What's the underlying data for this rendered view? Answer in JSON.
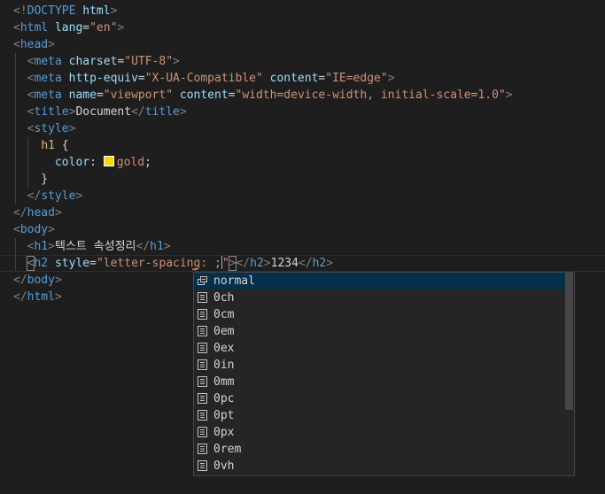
{
  "code_lines": [
    [
      {
        "c": "t-bracket",
        "t": "<!"
      },
      {
        "c": "t-tag",
        "t": "DOCTYPE"
      },
      {
        "c": "t-text",
        "t": " "
      },
      {
        "c": "t-attr",
        "t": "html"
      },
      {
        "c": "t-bracket",
        "t": ">"
      }
    ],
    [
      {
        "c": "t-bracket",
        "t": "<"
      },
      {
        "c": "t-tag",
        "t": "html"
      },
      {
        "c": "t-text",
        "t": " "
      },
      {
        "c": "t-attr",
        "t": "lang"
      },
      {
        "c": "t-text",
        "t": "="
      },
      {
        "c": "t-str",
        "t": "\"en\""
      },
      {
        "c": "t-bracket",
        "t": ">"
      }
    ],
    [
      {
        "c": "t-bracket",
        "t": "<"
      },
      {
        "c": "t-tag",
        "t": "head"
      },
      {
        "c": "t-bracket",
        "t": ">"
      }
    ],
    [
      {
        "c": "t-text",
        "t": "  "
      },
      {
        "c": "t-bracket",
        "t": "<"
      },
      {
        "c": "t-tag",
        "t": "meta"
      },
      {
        "c": "t-text",
        "t": " "
      },
      {
        "c": "t-attr",
        "t": "charset"
      },
      {
        "c": "t-text",
        "t": "="
      },
      {
        "c": "t-str",
        "t": "\"UTF-8\""
      },
      {
        "c": "t-bracket",
        "t": ">"
      }
    ],
    [
      {
        "c": "t-text",
        "t": "  "
      },
      {
        "c": "t-bracket",
        "t": "<"
      },
      {
        "c": "t-tag",
        "t": "meta"
      },
      {
        "c": "t-text",
        "t": " "
      },
      {
        "c": "t-attr",
        "t": "http-equiv"
      },
      {
        "c": "t-text",
        "t": "="
      },
      {
        "c": "t-str",
        "t": "\"X-UA-Compatible\""
      },
      {
        "c": "t-text",
        "t": " "
      },
      {
        "c": "t-attr",
        "t": "content"
      },
      {
        "c": "t-text",
        "t": "="
      },
      {
        "c": "t-str",
        "t": "\"IE=edge\""
      },
      {
        "c": "t-bracket",
        "t": ">"
      }
    ],
    [
      {
        "c": "t-text",
        "t": "  "
      },
      {
        "c": "t-bracket",
        "t": "<"
      },
      {
        "c": "t-tag",
        "t": "meta"
      },
      {
        "c": "t-text",
        "t": " "
      },
      {
        "c": "t-attr",
        "t": "name"
      },
      {
        "c": "t-text",
        "t": "="
      },
      {
        "c": "t-str",
        "t": "\"viewport\""
      },
      {
        "c": "t-text",
        "t": " "
      },
      {
        "c": "t-attr",
        "t": "content"
      },
      {
        "c": "t-text",
        "t": "="
      },
      {
        "c": "t-str",
        "t": "\"width=device-width, initial-scale=1.0\""
      },
      {
        "c": "t-bracket",
        "t": ">"
      }
    ],
    [
      {
        "c": "t-text",
        "t": "  "
      },
      {
        "c": "t-bracket",
        "t": "<"
      },
      {
        "c": "t-tag",
        "t": "title"
      },
      {
        "c": "t-bracket",
        "t": ">"
      },
      {
        "c": "t-text",
        "t": "Document"
      },
      {
        "c": "t-bracket",
        "t": "</"
      },
      {
        "c": "t-tag",
        "t": "title"
      },
      {
        "c": "t-bracket",
        "t": ">"
      }
    ],
    [
      {
        "c": "t-text",
        "t": "  "
      },
      {
        "c": "t-bracket",
        "t": "<"
      },
      {
        "c": "t-tag",
        "t": "style"
      },
      {
        "c": "t-bracket",
        "t": ">"
      }
    ],
    [
      {
        "c": "t-text",
        "t": "    "
      },
      {
        "c": "t-sel",
        "t": "h1"
      },
      {
        "c": "t-text",
        "t": " {"
      }
    ],
    [
      {
        "c": "t-text",
        "t": "      "
      },
      {
        "c": "t-prop",
        "t": "color"
      },
      {
        "c": "t-punct",
        "t": ": "
      },
      {
        "c": "swatch",
        "t": ""
      },
      {
        "c": "t-val",
        "t": "gold"
      },
      {
        "c": "t-punct",
        "t": ";"
      }
    ],
    [
      {
        "c": "t-text",
        "t": "    }"
      }
    ],
    [
      {
        "c": "t-text",
        "t": "  "
      },
      {
        "c": "t-bracket",
        "t": "</"
      },
      {
        "c": "t-tag",
        "t": "style"
      },
      {
        "c": "t-bracket",
        "t": ">"
      }
    ],
    [
      {
        "c": "t-bracket",
        "t": "</"
      },
      {
        "c": "t-tag",
        "t": "head"
      },
      {
        "c": "t-bracket",
        "t": ">"
      }
    ],
    [
      {
        "c": "t-bracket",
        "t": "<"
      },
      {
        "c": "t-tag",
        "t": "body"
      },
      {
        "c": "t-bracket",
        "t": ">"
      }
    ],
    [
      {
        "c": "t-text",
        "t": "  "
      },
      {
        "c": "t-bracket",
        "t": "<"
      },
      {
        "c": "t-tag",
        "t": "h1"
      },
      {
        "c": "t-bracket",
        "t": ">"
      },
      {
        "c": "t-text",
        "t": "텍스트 속성정리"
      },
      {
        "c": "t-bracket",
        "t": "</"
      },
      {
        "c": "t-tag",
        "t": "h1"
      },
      {
        "c": "t-bracket",
        "t": ">"
      }
    ],
    [
      {
        "c": "t-text",
        "t": "  "
      },
      {
        "c": "t-bracket bracket-box",
        "t": "<"
      },
      {
        "c": "t-tag",
        "t": "h2"
      },
      {
        "c": "t-text",
        "t": " "
      },
      {
        "c": "t-attr",
        "t": "style"
      },
      {
        "c": "t-text",
        "t": "="
      },
      {
        "c": "t-str",
        "t": "\"letter-spacing: ;"
      },
      {
        "c": "cursor",
        "t": ""
      },
      {
        "c": "t-str",
        "t": "\""
      },
      {
        "c": "t-bracket bracket-box",
        "t": ">"
      },
      {
        "c": "t-bracket",
        "t": "</"
      },
      {
        "c": "t-tag",
        "t": "h2"
      },
      {
        "c": "t-bracket",
        "t": ">"
      },
      {
        "c": "t-text",
        "t": "1234"
      },
      {
        "c": "t-bracket",
        "t": "</"
      },
      {
        "c": "t-tag",
        "t": "h2"
      },
      {
        "c": "t-bracket",
        "t": ">"
      }
    ],
    [
      {
        "c": "t-bracket",
        "t": "</"
      },
      {
        "c": "t-tag",
        "t": "body"
      },
      {
        "c": "t-bracket",
        "t": ">"
      }
    ],
    [
      {
        "c": "t-bracket",
        "t": "</"
      },
      {
        "c": "t-tag",
        "t": "html"
      },
      {
        "c": "t-bracket",
        "t": ">"
      }
    ]
  ],
  "suggestions": {
    "selected_index": 0,
    "items": [
      {
        "label": "normal",
        "icon": "keyword-icon"
      },
      {
        "label": "0ch",
        "icon": "unit-icon"
      },
      {
        "label": "0cm",
        "icon": "unit-icon"
      },
      {
        "label": "0em",
        "icon": "unit-icon"
      },
      {
        "label": "0ex",
        "icon": "unit-icon"
      },
      {
        "label": "0in",
        "icon": "unit-icon"
      },
      {
        "label": "0mm",
        "icon": "unit-icon"
      },
      {
        "label": "0pc",
        "icon": "unit-icon"
      },
      {
        "label": "0pt",
        "icon": "unit-icon"
      },
      {
        "label": "0px",
        "icon": "unit-icon"
      },
      {
        "label": "0rem",
        "icon": "unit-icon"
      },
      {
        "label": "0vh",
        "icon": "unit-icon"
      }
    ]
  },
  "colors": {
    "background": "#1e1e1e",
    "tag": "#569cd6",
    "attribute": "#9cdcfe",
    "string": "#ce9178",
    "selected_suggestion": "#062f4a",
    "gold_swatch": "#ffd700"
  }
}
